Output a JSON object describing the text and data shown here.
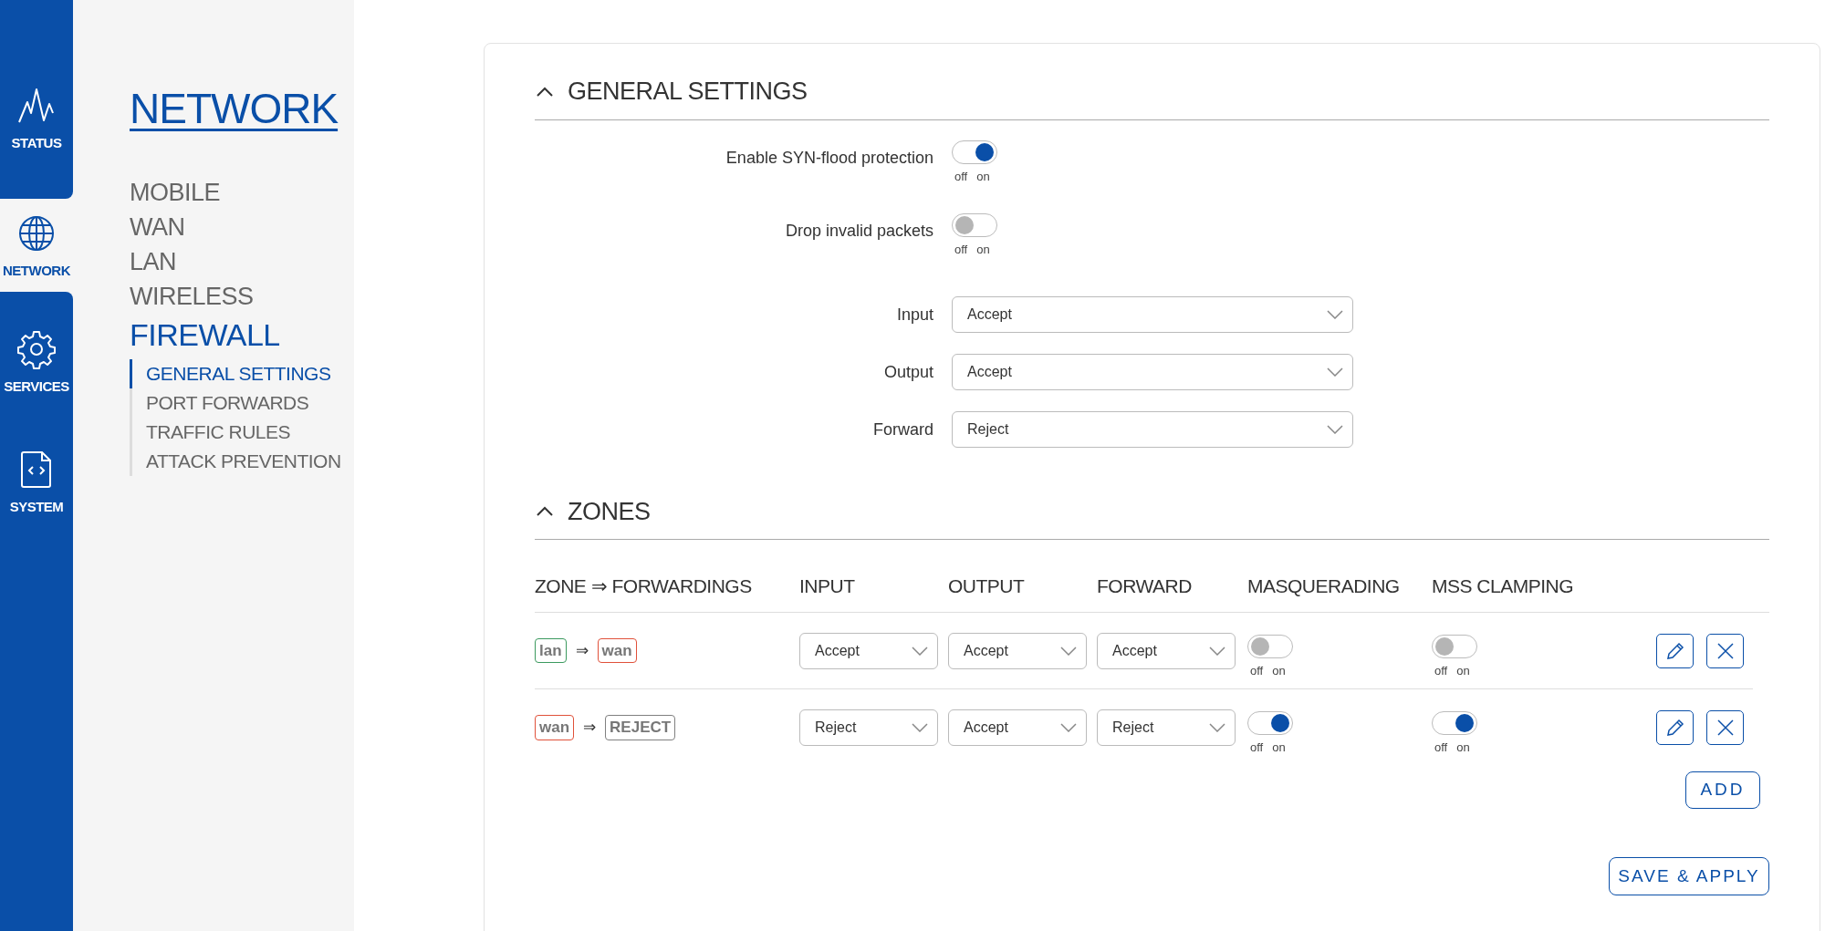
{
  "rail": [
    {
      "kind": "status",
      "label": "STATUS",
      "selected": false
    },
    {
      "kind": "network",
      "label": "NETWORK",
      "selected": true
    },
    {
      "kind": "services",
      "label": "SERVICES",
      "selected": false
    },
    {
      "kind": "system",
      "label": "SYSTEM",
      "selected": false
    }
  ],
  "sidebar": {
    "title": "NETWORK",
    "items": [
      {
        "label": "MOBILE",
        "selected": false
      },
      {
        "label": "WAN",
        "selected": false
      },
      {
        "label": "LAN",
        "selected": false
      },
      {
        "label": "WIRELESS",
        "selected": false
      },
      {
        "label": "FIREWALL",
        "selected": true,
        "children": [
          {
            "label": "GENERAL SETTINGS",
            "selected": true
          },
          {
            "label": "PORT FORWARDS",
            "selected": false
          },
          {
            "label": "TRAFFIC RULES",
            "selected": false
          },
          {
            "label": "ATTACK PREVENTION",
            "selected": false
          }
        ]
      }
    ]
  },
  "general": {
    "title": "GENERAL SETTINGS",
    "expanded": true,
    "toggles": [
      {
        "label": "Enable SYN-flood protection",
        "on": true,
        "off_label": "off",
        "on_label": "on"
      },
      {
        "label": "Drop invalid packets",
        "on": false,
        "off_label": "off",
        "on_label": "on"
      }
    ],
    "selects": [
      {
        "label": "Input",
        "value": "Accept"
      },
      {
        "label": "Output",
        "value": "Accept"
      },
      {
        "label": "Forward",
        "value": "Reject"
      }
    ]
  },
  "zones": {
    "title": "ZONES",
    "expanded": true,
    "columns": [
      "ZONE ⇒ FORWARDINGS",
      "INPUT",
      "OUTPUT",
      "FORWARD",
      "MASQUERADING",
      "MSS CLAMPING"
    ],
    "rows": [
      {
        "from": {
          "label": "lan",
          "color": "#3c9a5f"
        },
        "arrow": "⇒",
        "to": {
          "label": "wan",
          "color": "#e0513a"
        },
        "input": "Accept",
        "output": "Accept",
        "forward": "Accept",
        "masquerading": {
          "on": false,
          "off_label": "off",
          "on_label": "on"
        },
        "mss_clamping": {
          "on": false,
          "off_label": "off",
          "on_label": "on"
        }
      },
      {
        "from": {
          "label": "wan",
          "color": "#e0513a"
        },
        "arrow": "⇒",
        "to": {
          "label": "REJECT",
          "color": "#808080"
        },
        "input": "Reject",
        "output": "Accept",
        "forward": "Reject",
        "masquerading": {
          "on": true,
          "off_label": "off",
          "on_label": "on"
        },
        "mss_clamping": {
          "on": true,
          "off_label": "off",
          "on_label": "on"
        }
      }
    ],
    "add": "ADD"
  },
  "save": "SAVE & APPLY"
}
